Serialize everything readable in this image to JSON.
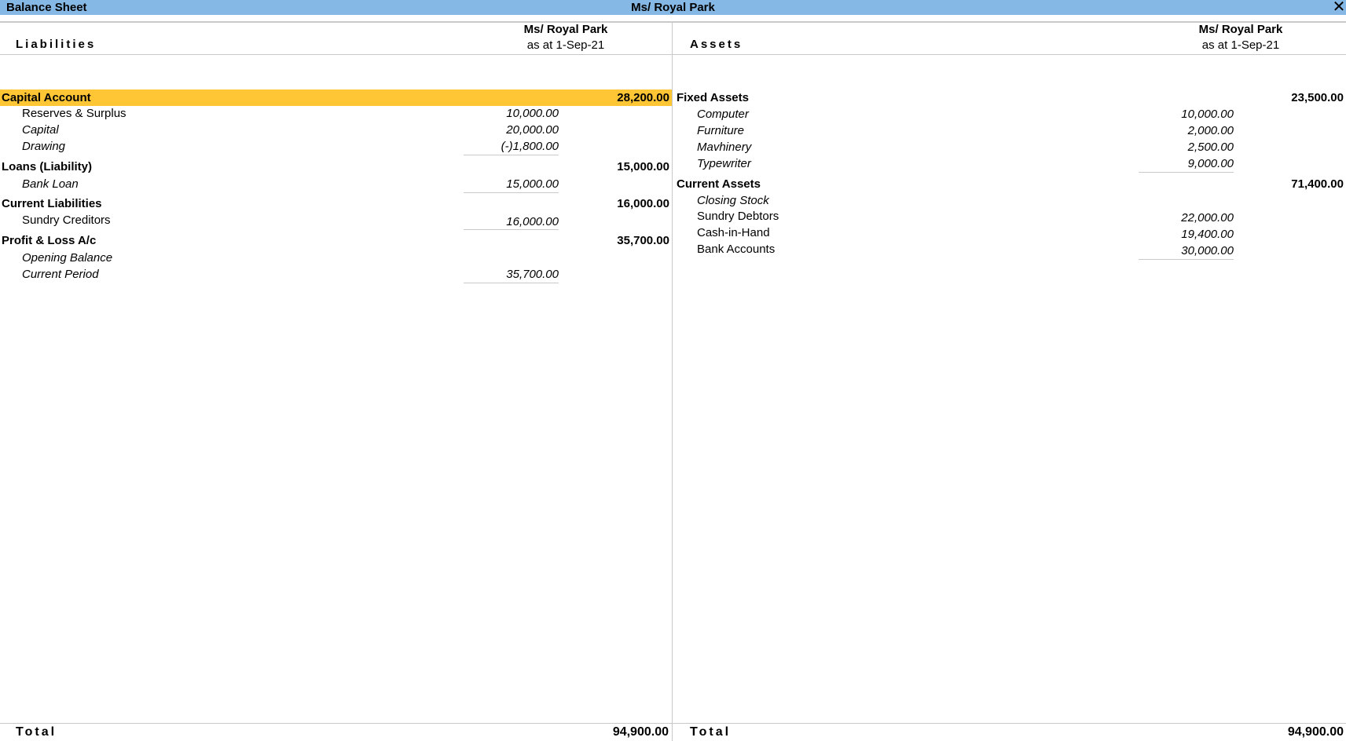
{
  "window": {
    "title": "Balance Sheet",
    "company": "Ms/ Royal Park",
    "close_icon": "close-icon"
  },
  "liabilities": {
    "heading": "Liabilities",
    "column": {
      "company": "Ms/ Royal Park",
      "period": "as at 1-Sep-21"
    },
    "groups": [
      {
        "label": "Capital Account",
        "total": "28,200.00",
        "selected": true,
        "items": [
          {
            "label": "Reserves & Surplus",
            "amount": "10,000.00",
            "italic": false
          },
          {
            "label": "Capital",
            "amount": "20,000.00",
            "italic": true
          },
          {
            "label": "Drawing",
            "amount": "(-)1,800.00",
            "italic": true
          }
        ]
      },
      {
        "label": "Loans (Liability)",
        "total": "15,000.00",
        "items": [
          {
            "label": "Bank Loan",
            "amount": "15,000.00",
            "italic": true
          }
        ]
      },
      {
        "label": "Current Liabilities",
        "total": "16,000.00",
        "items": [
          {
            "label": "Sundry Creditors",
            "amount": "16,000.00",
            "italic": false
          }
        ]
      },
      {
        "label": "Profit & Loss A/c",
        "total": "35,700.00",
        "items": [
          {
            "label": "Opening Balance",
            "amount": "",
            "italic": true
          },
          {
            "label": "Current Period",
            "amount": "35,700.00",
            "italic": true
          }
        ]
      }
    ],
    "total_label": "Total",
    "total": "94,900.00"
  },
  "assets": {
    "heading": "Assets",
    "column": {
      "company": "Ms/ Royal Park",
      "period": "as at 1-Sep-21"
    },
    "groups": [
      {
        "label": "Fixed Assets",
        "total": "23,500.00",
        "items": [
          {
            "label": "Computer",
            "amount": "10,000.00",
            "italic": true
          },
          {
            "label": "Furniture",
            "amount": "2,000.00",
            "italic": true
          },
          {
            "label": "Mavhinery",
            "amount": "2,500.00",
            "italic": true
          },
          {
            "label": "Typewriter",
            "amount": "9,000.00",
            "italic": true
          }
        ]
      },
      {
        "label": "Current Assets",
        "total": "71,400.00",
        "items": [
          {
            "label": "Closing Stock",
            "amount": "",
            "italic": true
          },
          {
            "label": "Sundry Debtors",
            "amount": "22,000.00",
            "italic": false
          },
          {
            "label": "Cash-in-Hand",
            "amount": "19,400.00",
            "italic": false
          },
          {
            "label": "Bank Accounts",
            "amount": "30,000.00",
            "italic": false
          }
        ]
      }
    ],
    "total_label": "Total",
    "total": "94,900.00"
  }
}
